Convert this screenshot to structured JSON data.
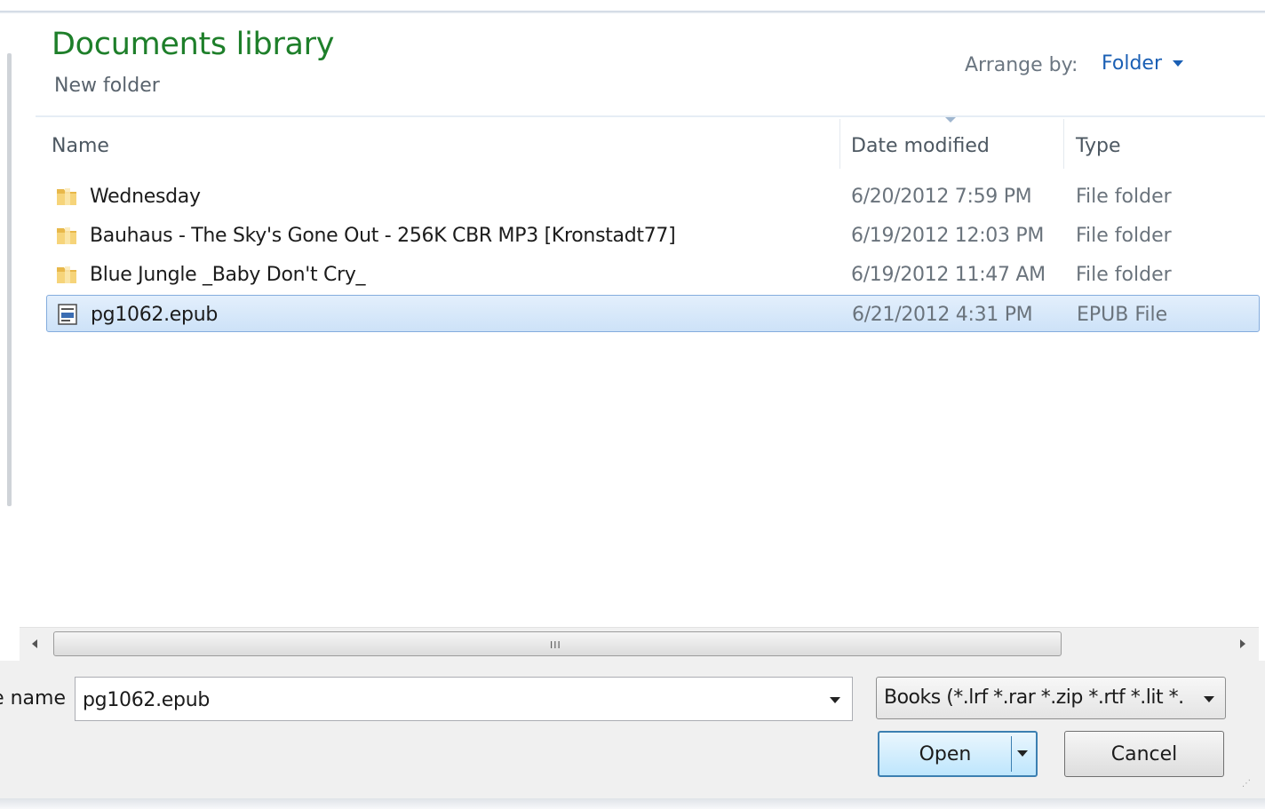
{
  "header": {
    "title": "Documents library",
    "subtitle": "New folder",
    "arrange_label": "Arrange by:",
    "arrange_value": "Folder"
  },
  "columns": {
    "name": "Name",
    "date": "Date modified",
    "type": "Type"
  },
  "files": [
    {
      "name": "Wednesday",
      "date": "6/20/2012 7:59 PM",
      "type": "File folder",
      "icon": "folder-icon"
    },
    {
      "name": "Bauhaus - The Sky's Gone Out - 256K CBR MP3 [Kronstadt77]",
      "date": "6/19/2012 12:03 PM",
      "type": "File folder",
      "icon": "folder-icon"
    },
    {
      "name": "Blue Jungle _Baby Don't Cry_",
      "date": "6/19/2012 11:47 AM",
      "type": "File folder",
      "icon": "folder-icon"
    },
    {
      "name": "pg1062.epub",
      "date": "6/21/2012 4:31 PM",
      "type": "EPUB File",
      "icon": "epub-file-icon",
      "selected": true
    }
  ],
  "scrollbar": {
    "grip": "III"
  },
  "footer": {
    "filename_label": "File name:",
    "filename_value": "pg1062.epub",
    "filetype_value": "Books (*.lrf *.rar *.zip *.rtf *.lit *.",
    "open_label": "Open",
    "cancel_label": "Cancel"
  },
  "colors": {
    "title": "#1e7f2a",
    "link": "#1a5fb4",
    "selection": "#cde2f8"
  }
}
